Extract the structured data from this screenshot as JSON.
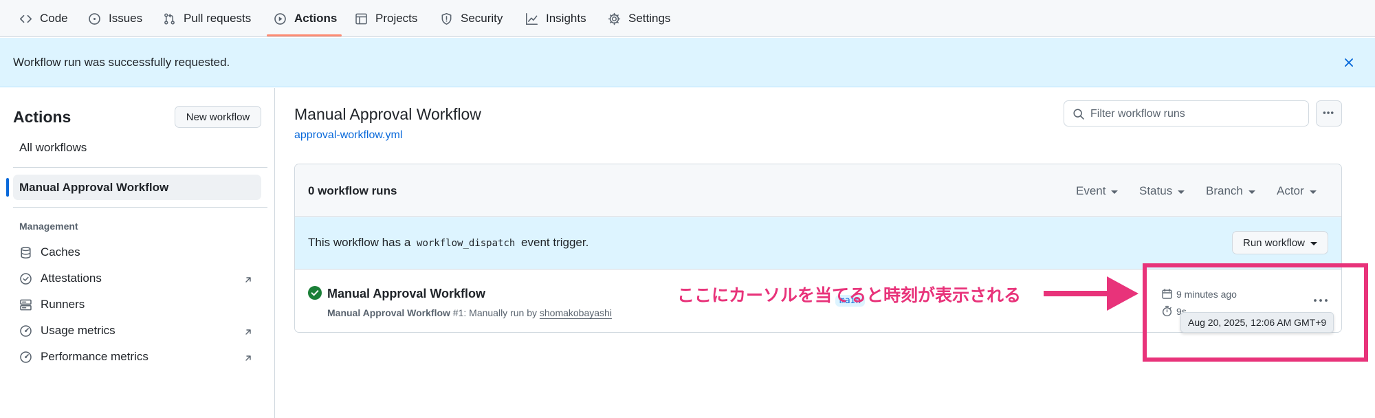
{
  "nav": {
    "items": [
      {
        "label": "Code",
        "icon": "code-icon"
      },
      {
        "label": "Issues",
        "icon": "issue-circle-icon"
      },
      {
        "label": "Pull requests",
        "icon": "pull-request-icon"
      },
      {
        "label": "Actions",
        "icon": "play-circle-icon",
        "active": true
      },
      {
        "label": "Projects",
        "icon": "table-icon"
      },
      {
        "label": "Security",
        "icon": "shield-icon"
      },
      {
        "label": "Insights",
        "icon": "graph-icon"
      },
      {
        "label": "Settings",
        "icon": "gear-icon"
      }
    ]
  },
  "flash": {
    "message": "Workflow run was successfully requested.",
    "close_icon": "x-icon"
  },
  "sidebar": {
    "title": "Actions",
    "new_workflow_label": "New workflow",
    "all_workflows_label": "All workflows",
    "selected_workflow_label": "Manual Approval Workflow",
    "management_heading": "Management",
    "management_items": [
      {
        "label": "Caches",
        "icon": "database-icon",
        "external": false
      },
      {
        "label": "Attestations",
        "icon": "verified-icon",
        "external": true
      },
      {
        "label": "Runners",
        "icon": "server-icon",
        "external": false
      },
      {
        "label": "Usage metrics",
        "icon": "meter-icon",
        "external": true
      },
      {
        "label": "Performance metrics",
        "icon": "meter-icon",
        "external": true
      }
    ]
  },
  "main": {
    "title": "Manual Approval Workflow",
    "file_link": "approval-workflow.yml",
    "search_placeholder": "Filter workflow runs",
    "run_count": "0 workflow runs",
    "filters": [
      "Event",
      "Status",
      "Branch",
      "Actor"
    ],
    "dispatch": {
      "prefix": "This workflow has a",
      "code": "workflow_dispatch",
      "suffix": "event trigger.",
      "button_label": "Run workflow"
    },
    "run": {
      "title": "Manual Approval Workflow",
      "meta_workflow": "Manual Approval Workflow",
      "meta_number": "#1",
      "meta_text": ": Manually run by",
      "meta_actor": "shomakobayashi",
      "branch": "main",
      "time_ago": "9 minutes ago",
      "duration": "9s",
      "status": "success",
      "tooltip": "Aug 20, 2025, 12:06 AM GMT+9"
    }
  },
  "annotation": {
    "text": "ここにカーソルを当てると時刻が表示される",
    "color": "#e8337a"
  },
  "colors": {
    "accent": "#0969da",
    "active_tab_underline": "#fd8c73",
    "success": "#1a7f37",
    "flash_bg": "#ddf4ff"
  }
}
